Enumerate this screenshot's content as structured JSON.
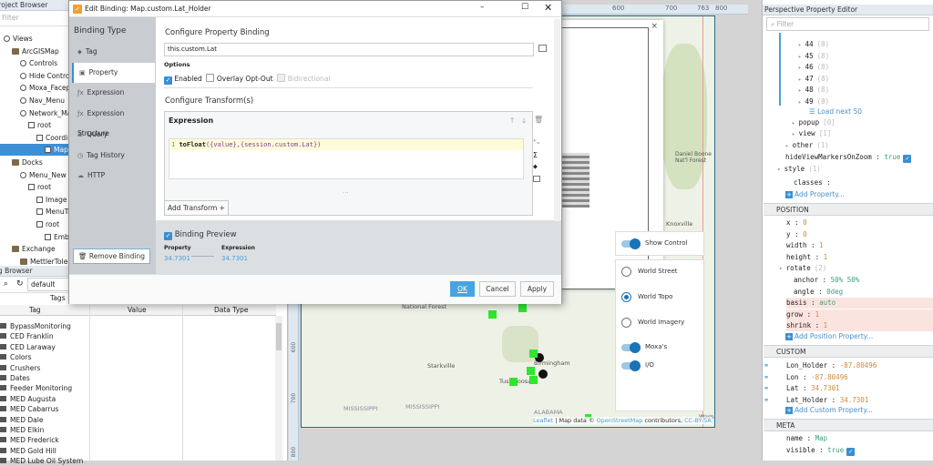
{
  "project_browser": {
    "title": "Project Browser",
    "filter_placeholder": "Filter",
    "tree": [
      {
        "label": "Views",
        "depth": 0,
        "icon": "views-icon"
      },
      {
        "label": "ArcGISMap",
        "depth": 1,
        "icon": "folder-icon"
      },
      {
        "label": "Controls",
        "depth": 2,
        "icon": "view-icon"
      },
      {
        "label": "Hide Controls",
        "depth": 2,
        "icon": "view-icon"
      },
      {
        "label": "Moxa_Faceplate",
        "depth": 2,
        "icon": "view-icon"
      },
      {
        "label": "Nav_Menu",
        "depth": 2,
        "icon": "view-icon"
      },
      {
        "label": "Network_Map",
        "depth": 2,
        "icon": "view-check-icon"
      },
      {
        "label": "root",
        "depth": 3,
        "icon": "container-icon"
      },
      {
        "label": "Coordinate",
        "depth": 4,
        "icon": "coordinate-icon"
      },
      {
        "label": "Map",
        "depth": 5,
        "icon": "map-icon",
        "selected": true
      },
      {
        "label": "Docks",
        "depth": 1,
        "icon": "folder-icon"
      },
      {
        "label": "Menu_New",
        "depth": 2,
        "icon": "view-check-icon"
      },
      {
        "label": "root",
        "depth": 3,
        "icon": "container-icon"
      },
      {
        "label": "Image",
        "depth": 4,
        "icon": "image-icon"
      },
      {
        "label": "MenuTree",
        "depth": 4,
        "icon": "menu-tree-icon"
      },
      {
        "label": "root",
        "depth": 4,
        "icon": "container-icon"
      },
      {
        "label": "Embedded",
        "depth": 5,
        "icon": "embedded-icon"
      },
      {
        "label": "Exchange",
        "depth": 1,
        "icon": "folder-icon"
      },
      {
        "label": "MettlerToledo",
        "depth": 2,
        "icon": "folder-icon"
      }
    ]
  },
  "tag_browser": {
    "title": "Tag Browser",
    "provider": "default",
    "tab": "Tags",
    "columns": [
      "Tag",
      "Value",
      "Data Type"
    ],
    "rows": [
      "BypassMonitoring",
      "CED Franklin",
      "CED Laraway",
      "Colors",
      "Crushers",
      "Dates",
      "Feeder Monitoring",
      "MED Augusta",
      "MED Cabarrus",
      "MED Dale",
      "MED Elkin",
      "MED Frederick",
      "MED Gold Hill",
      "MED Lube Oil System"
    ]
  },
  "dialog": {
    "title": "Edit Binding: Map.custom.Lat_Holder",
    "binding_type_label": "Binding Type",
    "binding_types": [
      {
        "label": "Tag",
        "icon": "tag-icon"
      },
      {
        "label": "Property",
        "icon": "property-icon",
        "active": true
      },
      {
        "label": "Expression",
        "icon": "fx-icon"
      },
      {
        "label": "Expression Structure",
        "icon": "fx-icon"
      },
      {
        "label": "Query",
        "icon": "database-icon"
      },
      {
        "label": "Tag History",
        "icon": "clock-icon"
      },
      {
        "label": "HTTP",
        "icon": "cloud-icon"
      }
    ],
    "remove_binding": "Remove Binding",
    "configure_heading": "Configure Property Binding",
    "property_path": "this.custom.Lat",
    "options_label": "Options",
    "options": [
      {
        "label": "Enabled",
        "checked": true
      },
      {
        "label": "Overlay Opt-Out",
        "checked": false
      },
      {
        "label": "Bidirectional",
        "checked": false,
        "disabled": true
      }
    ],
    "transform_heading": "Configure Transform(s)",
    "transform": {
      "title": "Expression",
      "line_number": "1",
      "code_fn": "toFloat",
      "code_args": "({value},{session.custom.Lat})"
    },
    "add_transform": "Add Transform +",
    "preview": {
      "label": "Binding Preview",
      "checked": true,
      "property_label": "Property",
      "property_value": "34.7301",
      "expression_label": "Expression",
      "expression_value": "34.7301"
    },
    "ok": "OK",
    "cancel": "Cancel",
    "apply": "Apply"
  },
  "canvas": {
    "ruler_top": [
      "600",
      "700",
      "763",
      "800"
    ],
    "ruler_left": [
      "600",
      "700",
      "800"
    ],
    "map_labels": {
      "starkville": "Starkville",
      "tuscaloosa": "Tuscaloosa",
      "birmingham": "Birmingham",
      "alabama": "ALABAMA",
      "mississippi1": "MISSISSIPPI",
      "mississippi2": "MISSISSIPPI",
      "forest": "National Forest",
      "daniel_boone": "Daniel Boone Nat'l Forest",
      "knoxville": "Knoxville",
      "warner": "Warner"
    },
    "attribution": {
      "leaflet": "Leaflet",
      "mid": " | Map data © ",
      "osm": "OpenStreetMap",
      "contrib": " contributors, ",
      "license": "CC-BY-SA"
    },
    "layer_control": {
      "show_control": "Show Control",
      "basemaps": [
        {
          "label": "World Street",
          "selected": false
        },
        {
          "label": "World Topo",
          "selected": true
        },
        {
          "label": "World Imagery",
          "selected": false
        }
      ],
      "overlays": [
        {
          "label": "Moxa's",
          "on": true
        },
        {
          "label": "I/O",
          "on": true
        }
      ]
    }
  },
  "property_editor": {
    "title": "Perspective Property Editor",
    "filter_placeholder": "Filter",
    "items": [
      {
        "key": "44",
        "count": "(8)"
      },
      {
        "key": "45",
        "count": "(8)"
      },
      {
        "key": "46",
        "count": "(8)"
      },
      {
        "key": "47",
        "count": "(8)"
      },
      {
        "key": "48",
        "count": "(8)"
      },
      {
        "key": "49",
        "count": "(8)"
      }
    ],
    "load_next": "Load next 50",
    "popup": {
      "key": "popup",
      "count": "[0]"
    },
    "view": {
      "key": "view",
      "count": "[1]"
    },
    "other": {
      "key": "other",
      "count": "(1)"
    },
    "hideViewMarkersOnZoom": {
      "key": "hideViewMarkersOnZoom",
      "value": "true"
    },
    "style": {
      "key": "style",
      "count": "(1)"
    },
    "classes": {
      "key": "classes",
      "value": ""
    },
    "add_property": "Add Property...",
    "position": {
      "header": "POSITION",
      "rows": [
        {
          "key": "x",
          "value": "0"
        },
        {
          "key": "y",
          "value": "0"
        },
        {
          "key": "width",
          "value": "1"
        },
        {
          "key": "height",
          "value": "1"
        }
      ],
      "rotate": {
        "key": "rotate",
        "count": "(2)"
      },
      "rotate_rows": [
        {
          "key": "anchor",
          "value": "50% 50%"
        },
        {
          "key": "angle",
          "value": "0deg"
        }
      ],
      "flex_rows": [
        {
          "key": "basis",
          "value": "auto"
        },
        {
          "key": "grow",
          "value": "1"
        },
        {
          "key": "shrink",
          "value": "1"
        }
      ],
      "add": "Add Position Property..."
    },
    "custom": {
      "header": "CUSTOM",
      "rows": [
        {
          "key": "Lon_Holder",
          "value": "-87.80496"
        },
        {
          "key": "Lon",
          "value": "-87.80496"
        },
        {
          "key": "Lat",
          "value": "34.7301"
        },
        {
          "key": "Lat_Holder",
          "value": "34.7301"
        }
      ],
      "add": "Add Custom Property..."
    },
    "meta": {
      "header": "META",
      "rows": [
        {
          "key": "name",
          "value": "Map"
        },
        {
          "key": "visible",
          "value": "true"
        }
      ]
    }
  }
}
